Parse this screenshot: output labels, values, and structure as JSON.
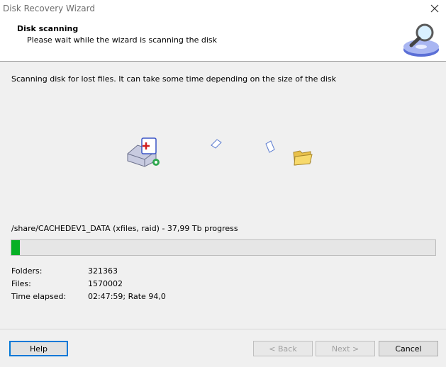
{
  "window": {
    "title": "Disk Recovery Wizard"
  },
  "header": {
    "title": "Disk scanning",
    "subtitle": "Please wait while the wizard is scanning the disk"
  },
  "main": {
    "description": "Scanning disk for lost files. It can take some time depending on the size of the disk",
    "progress_label": "/share/CACHEDEV1_DATA (xfiles, raid) - 37,99 Tb progress",
    "progress_fraction": 0.02,
    "stats": [
      {
        "label": "Folders:",
        "value": "321363"
      },
      {
        "label": "Files:",
        "value": "1570002"
      },
      {
        "label": "Time elapsed:",
        "value": "02:47:59; Rate 94,0"
      }
    ]
  },
  "footer": {
    "help_label": "Help",
    "back_label": "< Back",
    "next_label": "Next >",
    "cancel_label": "Cancel"
  },
  "icons": {
    "header": "magnifier-disk-icon",
    "disk": "hard-disk-icon",
    "folder": "folder-icon",
    "close": "close-icon"
  },
  "colors": {
    "progress": "#06b025",
    "default_button_border": "#0078d7"
  }
}
